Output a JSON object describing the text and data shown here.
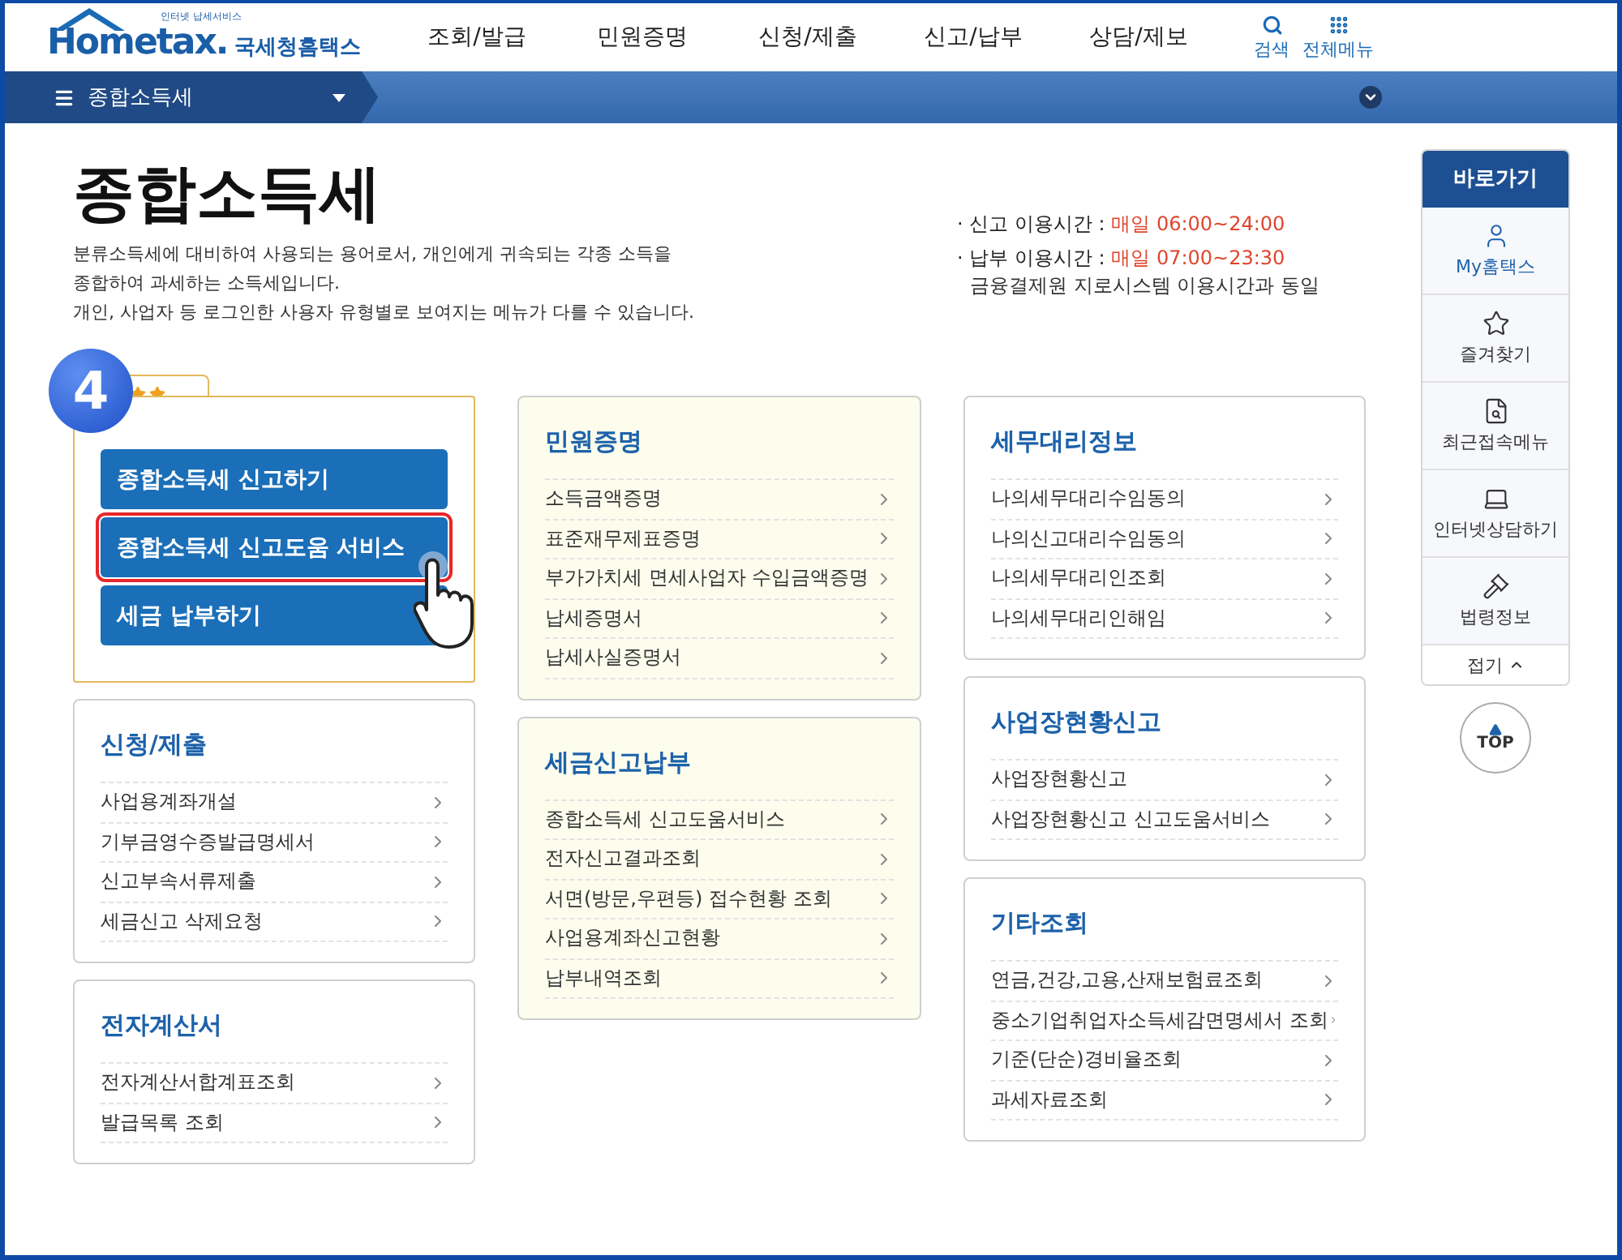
{
  "logo": {
    "tagline": "인터넷 납세서비스",
    "brand": "Hometax.",
    "name": "국세청홈택스"
  },
  "nav": [
    "조회/발급",
    "민원증명",
    "신청/제출",
    "신고/납부",
    "상담/제보"
  ],
  "tools": [
    {
      "label": "검색",
      "kind": "search"
    },
    {
      "label": "전체메뉴",
      "kind": "grid"
    }
  ],
  "breadcrumb": {
    "label": "종합소득세"
  },
  "page": {
    "title": "종합소득세",
    "description": [
      "분류소득세에 대비하여 사용되는 용어로서, 개인에게 귀속되는 각종 소득을",
      "종합하여 과세하는 소득세입니다.",
      "개인, 사업자 등 로그인한 사용자 유형별로 보여지는 메뉴가 다를 수 있습니다."
    ]
  },
  "hours": [
    {
      "label": "· 신고 이용시간 : ",
      "value": "매일 06:00~24:00"
    },
    {
      "label": "· 납부 이용시간 : ",
      "value": "매일 07:00~23:30",
      "note": "금융결제원 지로시스템 이용시간과 동일"
    }
  ],
  "step": {
    "number": "4"
  },
  "featured": {
    "buttons": [
      {
        "label": "종합소득세 신고하기",
        "highlighted": false
      },
      {
        "label": "종합소득세 신고도움 서비스",
        "highlighted": true
      },
      {
        "label": "세금 납부하기",
        "highlighted": false
      }
    ]
  },
  "columns": [
    [
      {
        "title": "신청/제출",
        "kind": "plain",
        "items": [
          "사업용계좌개설",
          "기부금영수증발급명세서",
          "신고부속서류제출",
          "세금신고 삭제요청"
        ]
      },
      {
        "title": "전자계산서",
        "kind": "plain",
        "items": [
          "전자계산서합계표조회",
          "발급목록 조회"
        ]
      }
    ],
    [
      {
        "title": "민원증명",
        "kind": "cream",
        "items": [
          "소득금액증명",
          "표준재무제표증명",
          "부가가치세 면세사업자 수입금액증명",
          "납세증명서",
          "납세사실증명서"
        ]
      },
      {
        "title": "세금신고납부",
        "kind": "cream",
        "items": [
          "종합소득세 신고도움서비스",
          "전자신고결과조회",
          "서면(방문,우편등) 접수현황 조회",
          "사업용계좌신고현황",
          "납부내역조회"
        ]
      }
    ],
    [
      {
        "title": "세무대리정보",
        "kind": "plain",
        "items": [
          "나의세무대리수임동의",
          "나의신고대리수임동의",
          "나의세무대리인조회",
          "나의세무대리인해임"
        ]
      },
      {
        "title": "사업장현황신고",
        "kind": "plain",
        "items": [
          "사업장현황신고",
          "사업장현황신고 신고도움서비스"
        ]
      },
      {
        "title": "기타조회",
        "kind": "plain",
        "items": [
          "연금,건강,고용,산재보험료조회",
          "중소기업취업자소득세감면명세서 조회",
          "기준(단순)경비율조회",
          "과세자료조회"
        ]
      }
    ]
  ],
  "quick": {
    "title": "바로가기",
    "items": [
      {
        "label": "My홈택스",
        "kind": "user",
        "selected": true
      },
      {
        "label": "즐겨찾기",
        "kind": "star",
        "selected": false
      },
      {
        "label": "최근접속메뉴",
        "kind": "recent",
        "selected": false
      },
      {
        "label": "인터넷상담하기",
        "kind": "laptop",
        "selected": false
      },
      {
        "label": "법령정보",
        "kind": "gavel",
        "selected": false
      }
    ],
    "collapse": "접기",
    "top": "TOP"
  }
}
